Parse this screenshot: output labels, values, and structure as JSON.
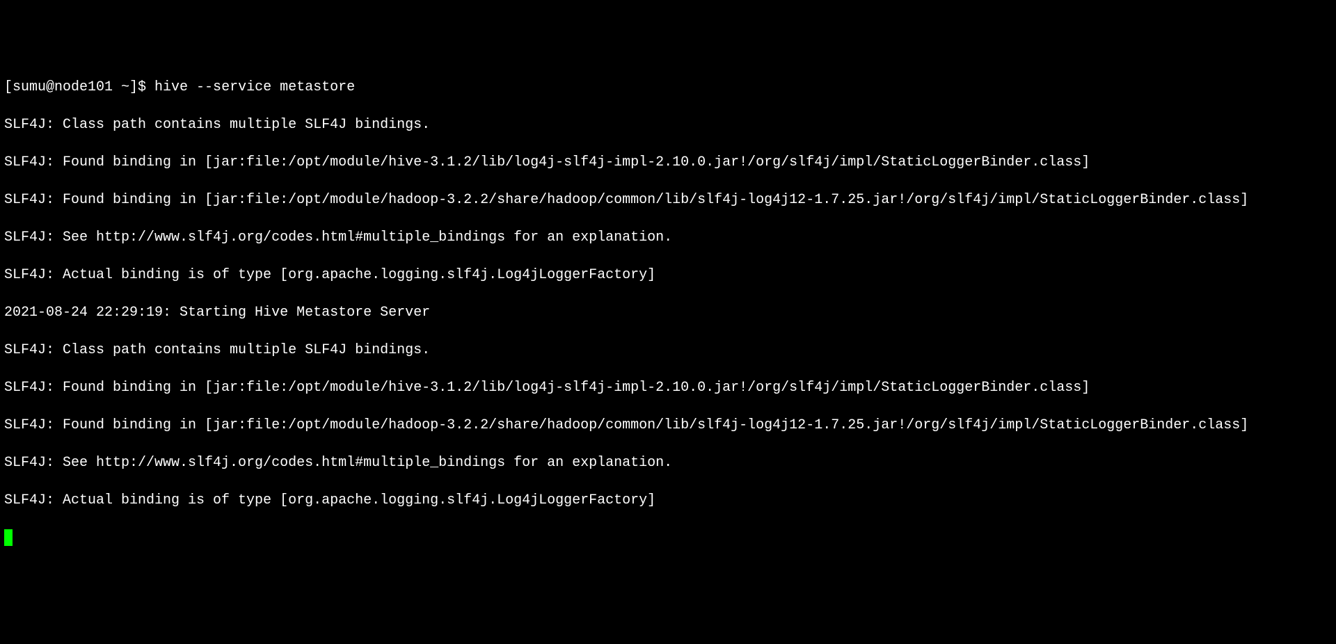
{
  "terminal": {
    "prompt": "[sumu@node101 ~]$ ",
    "command": "hive --service metastore",
    "lines": [
      "SLF4J: Class path contains multiple SLF4J bindings.",
      "SLF4J: Found binding in [jar:file:/opt/module/hive-3.1.2/lib/log4j-slf4j-impl-2.10.0.jar!/org/slf4j/impl/StaticLoggerBinder.class]",
      "SLF4J: Found binding in [jar:file:/opt/module/hadoop-3.2.2/share/hadoop/common/lib/slf4j-log4j12-1.7.25.jar!/org/slf4j/impl/StaticLoggerBinder.class]",
      "SLF4J: See http://www.slf4j.org/codes.html#multiple_bindings for an explanation.",
      "SLF4J: Actual binding is of type [org.apache.logging.slf4j.Log4jLoggerFactory]",
      "2021-08-24 22:29:19: Starting Hive Metastore Server",
      "SLF4J: Class path contains multiple SLF4J bindings.",
      "SLF4J: Found binding in [jar:file:/opt/module/hive-3.1.2/lib/log4j-slf4j-impl-2.10.0.jar!/org/slf4j/impl/StaticLoggerBinder.class]",
      "SLF4J: Found binding in [jar:file:/opt/module/hadoop-3.2.2/share/hadoop/common/lib/slf4j-log4j12-1.7.25.jar!/org/slf4j/impl/StaticLoggerBinder.class]",
      "SLF4J: See http://www.slf4j.org/codes.html#multiple_bindings for an explanation.",
      "SLF4J: Actual binding is of type [org.apache.logging.slf4j.Log4jLoggerFactory]"
    ]
  }
}
